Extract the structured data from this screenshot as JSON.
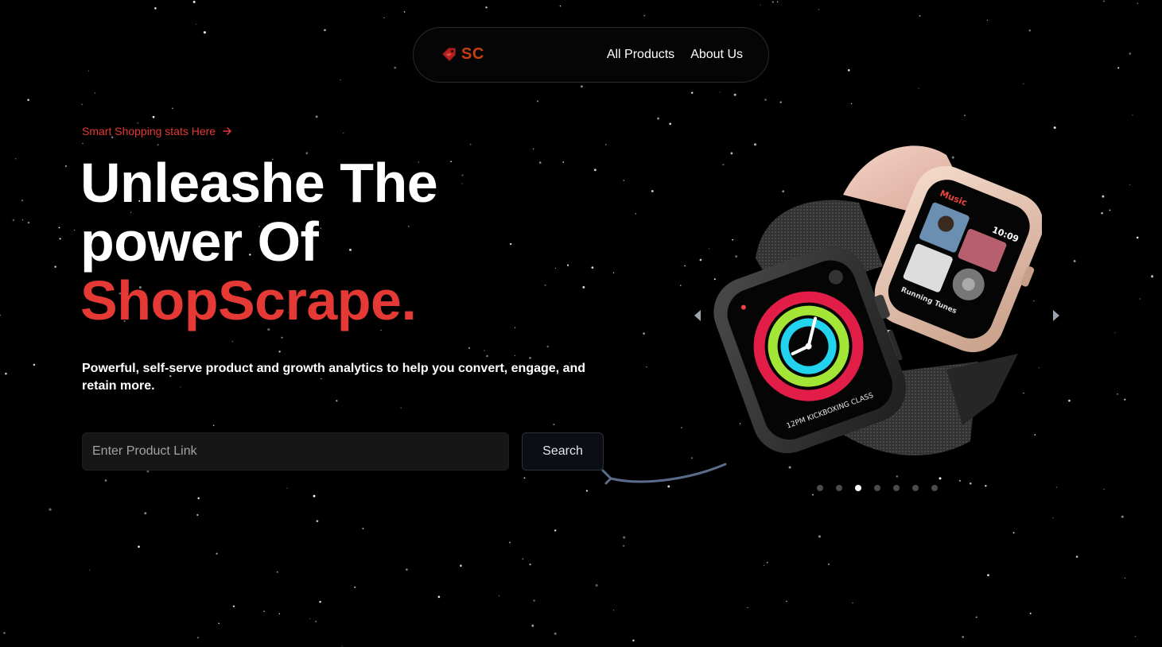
{
  "brand": {
    "logo_text": "SC",
    "logo_color": "#c2410c"
  },
  "nav": {
    "links": [
      {
        "label": "All Products"
      },
      {
        "label": "About Us"
      }
    ]
  },
  "hero": {
    "eyebrow": "Smart Shopping stats Here",
    "headline_line1": "Unleashe The",
    "headline_line2": "power Of",
    "headline_line3": "ShopScrape.",
    "subtext": "Powerful, self-serve product and growth analytics to help you convert, engage, and retain more.",
    "accent_color": "#e53935"
  },
  "search": {
    "placeholder": "Enter Product Link",
    "button_label": "Search"
  },
  "carousel": {
    "slide_count": 7,
    "active_index": 2,
    "watch_front": {
      "workout_label": "12PM KICKBOXING CLASS"
    },
    "watch_back": {
      "app_label": "Music",
      "time": "10:09",
      "track_label": "Running Tunes"
    }
  }
}
